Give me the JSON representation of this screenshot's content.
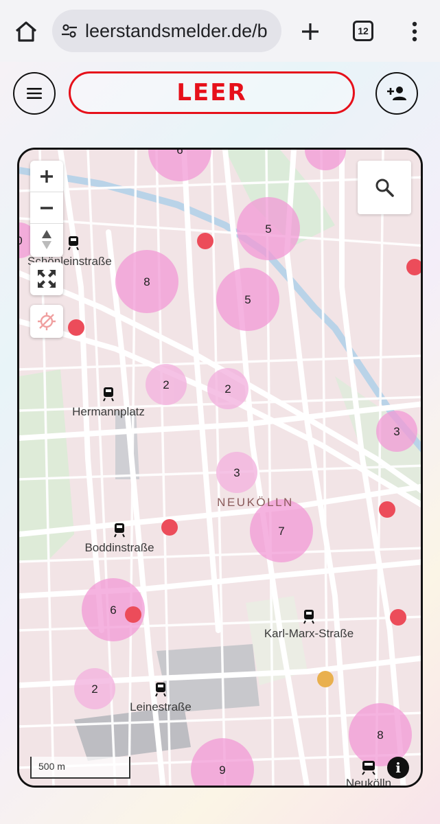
{
  "browser": {
    "url": "leerstandsmelder.de/b",
    "tab_count": "12"
  },
  "header": {
    "logo_text": "LEER",
    "accent": "#e6101a"
  },
  "map": {
    "district": "NEUKÖLLN",
    "scale": "500 m",
    "info_symbol": "i",
    "stations": [
      {
        "name": "Schönleinstraße"
      },
      {
        "name": "Hermannplatz"
      },
      {
        "name": "Boddinstraße"
      },
      {
        "name": "Karl-Marx-Straße"
      },
      {
        "name": "Leinestraße"
      },
      {
        "name": "Neukölln"
      }
    ],
    "clusters": [
      "6",
      "5",
      "8",
      "5",
      "2",
      "2",
      "3",
      "3",
      "7",
      "6",
      "2",
      "8",
      "9",
      "0"
    ],
    "colors": {
      "cluster": "#f29ad6",
      "single": "#ec4c5a",
      "other": "#e9b04e"
    }
  }
}
